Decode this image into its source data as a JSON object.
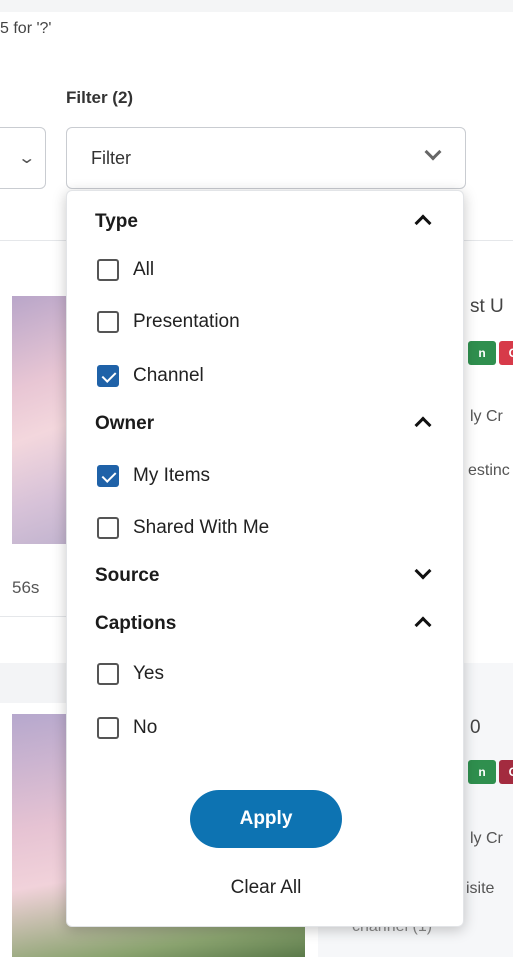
{
  "results": {
    "text": "5 for '?'"
  },
  "filter": {
    "title": "Filter (2)",
    "select_label": "Filter"
  },
  "background": {
    "card1_title_partial": "st U",
    "card1_meta_partial": "ly Cr",
    "card1_desc_partial": "estinc",
    "card1_duration": "56s",
    "card1_tag_a": "n",
    "card1_tag_b": "C",
    "card2_title_partial": "0",
    "card2_meta_partial": "ly Cr",
    "card2_desc_partial": "isite",
    "card2_sub_partial": "channel (1)",
    "card2_tag_a": "n",
    "card2_tag_b": "C"
  },
  "sections": [
    {
      "label": "Type",
      "expanded": true,
      "options": [
        {
          "label": "All",
          "checked": false
        },
        {
          "label": "Presentation",
          "checked": false
        },
        {
          "label": "Channel",
          "checked": true
        }
      ]
    },
    {
      "label": "Owner",
      "expanded": true,
      "options": [
        {
          "label": "My Items",
          "checked": true
        },
        {
          "label": "Shared With Me",
          "checked": false
        }
      ]
    },
    {
      "label": "Source",
      "expanded": false,
      "options": []
    },
    {
      "label": "Captions",
      "expanded": true,
      "options": [
        {
          "label": "Yes",
          "checked": false
        },
        {
          "label": "No",
          "checked": false
        }
      ]
    }
  ],
  "actions": {
    "apply_label": "Apply",
    "clear_label": "Clear All"
  },
  "colors": {
    "accent": "#0d73b2",
    "checkbox_checked": "#1f62a8",
    "tag_green": "#2f8f4e",
    "tag_red": "#d73a49"
  }
}
